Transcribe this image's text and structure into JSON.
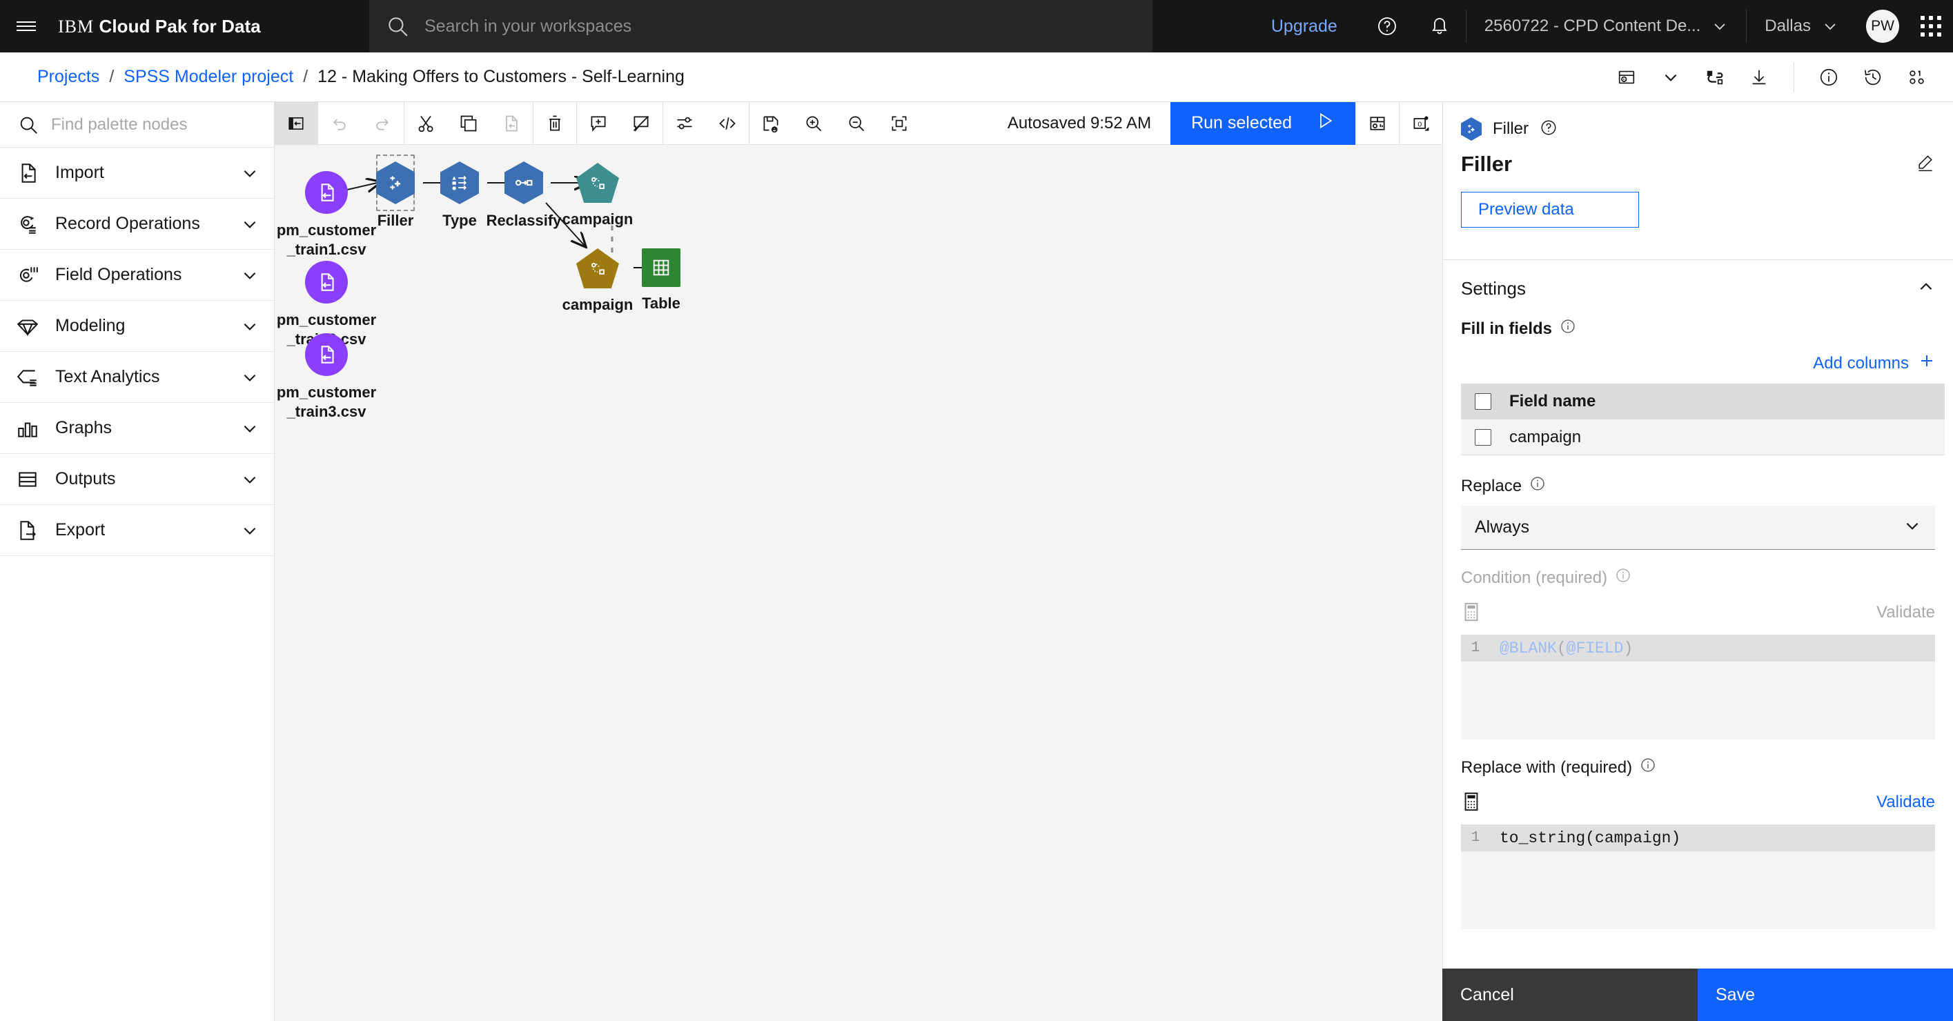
{
  "header": {
    "menu_icon": "hamburger-icon",
    "brand_prefix": "IBM",
    "brand_name": "Cloud Pak for Data",
    "search_placeholder": "Search in your workspaces",
    "search_value": "",
    "upgrade_label": "Upgrade",
    "help_icon": "help-icon",
    "notifications_icon": "bell-icon",
    "account_label": "2560722 - CPD Content De...",
    "region_label": "Dallas",
    "avatar_initials": "PW",
    "app_switcher_icon": "waffle-icon"
  },
  "breadcrumb": {
    "items": [
      {
        "label": "Projects",
        "current": false
      },
      {
        "label": "SPSS Modeler project",
        "current": false
      },
      {
        "label": "12 - Making Offers to Customers - Self-Learning",
        "current": true
      }
    ],
    "separator": "/",
    "icons": [
      "run-panel-icon",
      "chevron-down-icon",
      "flow-relationship-icon",
      "download-icon",
      "info-icon",
      "history-icon",
      "node-legend-icon"
    ]
  },
  "palette": {
    "search_placeholder": "Find palette nodes",
    "search_value": "",
    "items": [
      {
        "label": "Import",
        "icon": "import-icon"
      },
      {
        "label": "Record Operations",
        "icon": "record-operations-icon"
      },
      {
        "label": "Field Operations",
        "icon": "field-operations-icon"
      },
      {
        "label": "Modeling",
        "icon": "modeling-gem-icon"
      },
      {
        "label": "Text Analytics",
        "icon": "text-analytics-icon"
      },
      {
        "label": "Graphs",
        "icon": "graphs-bar-icon"
      },
      {
        "label": "Outputs",
        "icon": "outputs-table-icon"
      },
      {
        "label": "Export",
        "icon": "export-icon"
      }
    ]
  },
  "toolbar": {
    "buttons": [
      {
        "name": "toggle-palette",
        "icon": "panel-open-icon",
        "state": "active"
      },
      {
        "name": "undo",
        "icon": "undo-icon",
        "state": "disabled"
      },
      {
        "name": "redo",
        "icon": "redo-icon",
        "state": "disabled"
      },
      {
        "name": "cut",
        "icon": "scissors-icon",
        "state": "enabled"
      },
      {
        "name": "copy",
        "icon": "copy-icon",
        "state": "enabled"
      },
      {
        "name": "paste",
        "icon": "paste-icon",
        "state": "disabled"
      },
      {
        "name": "delete",
        "icon": "trash-icon",
        "state": "enabled"
      },
      {
        "name": "add-comment",
        "icon": "comment-plus-icon",
        "state": "enabled"
      },
      {
        "name": "delete-comment",
        "icon": "comment-slash-icon",
        "state": "enabled"
      },
      {
        "name": "settings",
        "icon": "sliders-icon",
        "state": "enabled"
      },
      {
        "name": "code-view",
        "icon": "code-icon",
        "state": "enabled"
      },
      {
        "name": "save-as-template",
        "icon": "save-flow-icon",
        "state": "enabled"
      },
      {
        "name": "zoom-in",
        "icon": "zoom-in-icon",
        "state": "enabled"
      },
      {
        "name": "zoom-out",
        "icon": "zoom-out-icon",
        "state": "enabled"
      },
      {
        "name": "zoom-to-fit",
        "icon": "fit-screen-icon",
        "state": "enabled"
      }
    ],
    "autosaved_label": "Autosaved 9:52 AM",
    "run_label": "Run selected",
    "run_icon": "play-icon",
    "outputs_icon": "outputs-panel-icon",
    "messages_icon": "messages-count-icon",
    "messages_count": "0"
  },
  "canvas": {
    "nodes": [
      {
        "id": "src1",
        "label": "pm_customer_train1.csv",
        "type": "import",
        "shape": "circle",
        "color": "#8a3ffc",
        "icon": "csv-import-icon",
        "selected": false
      },
      {
        "id": "src2",
        "label": "pm_customer_train2.csv",
        "type": "import",
        "shape": "circle",
        "color": "#8a3ffc",
        "icon": "csv-import-icon",
        "selected": false
      },
      {
        "id": "src3",
        "label": "pm_customer_train3.csv",
        "type": "import",
        "shape": "circle",
        "color": "#8a3ffc",
        "icon": "csv-import-icon",
        "selected": false
      },
      {
        "id": "filler",
        "label": "Filler",
        "type": "field-op",
        "shape": "hexagon",
        "color": "#3d70b2",
        "icon": "filler-plus-icon",
        "selected": true
      },
      {
        "id": "type",
        "label": "Type",
        "type": "field-op",
        "shape": "hexagon",
        "color": "#3d70b2",
        "icon": "type-list-icon",
        "selected": false
      },
      {
        "id": "reclassify",
        "label": "Reclassify",
        "type": "field-op",
        "shape": "hexagon",
        "color": "#3d70b2",
        "icon": "reclassify-icon",
        "selected": false
      },
      {
        "id": "model-teal",
        "label": "campaign",
        "type": "model",
        "shape": "pentagon",
        "color": "#3d8f8f",
        "icon": "model-nugget-icon",
        "selected": false
      },
      {
        "id": "model-gold",
        "label": "campaign",
        "type": "model-applied",
        "shape": "pentagon",
        "color": "#9c7a10",
        "icon": "model-nugget-icon",
        "selected": false
      },
      {
        "id": "table",
        "label": "Table",
        "type": "output",
        "shape": "square",
        "color": "#2d8633",
        "icon": "table-grid-icon",
        "selected": false
      }
    ]
  },
  "panel": {
    "node_icon": "filler-plus-icon",
    "node_type": "Filler",
    "help_icon": "help-circle-icon",
    "title": "Filler",
    "edit_icon": "edit-pencil-icon",
    "preview_label": "Preview data",
    "settings_title": "Settings",
    "settings_collapse_icon": "chevron-up-icon",
    "fill_in_fields_label": "Fill in fields",
    "fill_in_fields_info_icon": "info-icon",
    "add_columns_label": "Add columns",
    "add_columns_icon": "plus-icon",
    "table": {
      "columns": [
        "Field name"
      ],
      "rows": [
        {
          "field_name": "campaign",
          "checked": false
        }
      ],
      "header_checked": false
    },
    "replace_label": "Replace",
    "replace_info_icon": "info-icon",
    "replace_value": "Always",
    "replace_chevron_icon": "chevron-down-icon",
    "condition_label": "Condition (required)",
    "condition_info_icon": "info-icon",
    "condition_calc_icon": "calculator-icon",
    "condition_validate_label": "Validate",
    "condition_line_no": "1",
    "condition_code_fn": "@BLANK",
    "condition_code_open": "(",
    "condition_code_arg": "@FIELD",
    "condition_code_close": ")",
    "replace_with_label": "Replace with (required)",
    "replace_with_info_icon": "info-icon",
    "replace_with_calc_icon": "calculator-icon",
    "replace_with_validate_label": "Validate",
    "replace_with_line_no": "1",
    "replace_with_code": "to_string(campaign)"
  },
  "actions": {
    "cancel_label": "Cancel",
    "save_label": "Save"
  },
  "colors": {
    "brand_blue": "#0f62fe",
    "header_black": "#161616",
    "canvas_bg": "#f4f4f4",
    "import_purple": "#8a3ffc",
    "fieldop_blue": "#3d70b2",
    "model_teal": "#3d8f8f",
    "model_gold": "#9c7a10",
    "output_green": "#2d8633"
  }
}
